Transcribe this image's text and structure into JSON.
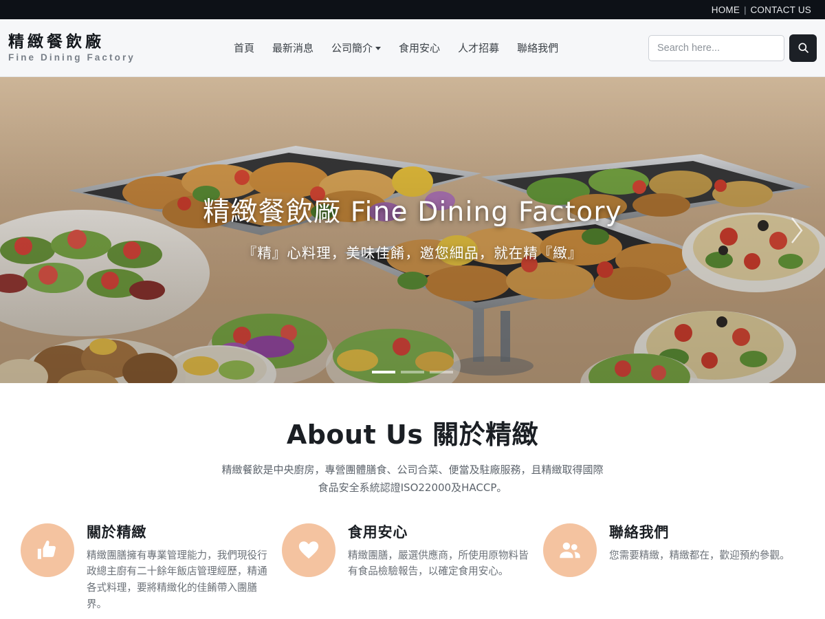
{
  "topbar": {
    "home_label": "HOME",
    "separator": "|",
    "contact_label": "CONTACT US"
  },
  "header": {
    "logo_cn": "精緻餐飲廠",
    "logo_en": "Fine Dining Factory",
    "nav": [
      {
        "label": "首頁",
        "has_dropdown": false
      },
      {
        "label": "最新消息",
        "has_dropdown": false
      },
      {
        "label": "公司簡介",
        "has_dropdown": true
      },
      {
        "label": "食用安心",
        "has_dropdown": false
      },
      {
        "label": "人才招募",
        "has_dropdown": false
      },
      {
        "label": "聯絡我們",
        "has_dropdown": false
      }
    ],
    "search": {
      "placeholder": "Search here...",
      "value": "",
      "button_icon": "search-icon"
    }
  },
  "hero": {
    "title": "精緻餐飲廠 Fine Dining Factory",
    "subtitle": "『精』心料理，美味佳餚，邀您細品，就在精『緻』",
    "next_icon": "chevron-right-icon",
    "prev_icon": "chevron-left-icon",
    "indicators": [
      {
        "active": true
      },
      {
        "active": false
      },
      {
        "active": false
      }
    ]
  },
  "about": {
    "title": "About Us 關於精緻",
    "description": "精緻餐飲是中央廚房，專營團體膳食、公司合菜、便當及駐廠服務，且精緻取得國際食品安全系統認證ISO22000及HACCP。"
  },
  "features": [
    {
      "icon": "thumbs-up-icon",
      "title": "關於精緻",
      "text": "精緻團膳擁有專業管理能力，我們現役行政總主廚有二十餘年飯店管理經歷，精通各式料理，要將精緻化的佳餚帶入團膳界。"
    },
    {
      "icon": "heart-icon",
      "title": "食用安心",
      "text": "精緻團膳，嚴選供應商，所使用原物料皆有食品檢驗報告，以確定食用安心。"
    },
    {
      "icon": "users-icon",
      "title": "聯絡我們",
      "text": "您需要精緻，精緻都在，歡迎預約參觀。"
    }
  ],
  "colors": {
    "topbar_bg": "#0d1117",
    "header_bg": "#f6f7f9",
    "accent_peach": "#f4c3a0",
    "text_dark": "#1b1f24",
    "text_muted": "#6b7178"
  }
}
